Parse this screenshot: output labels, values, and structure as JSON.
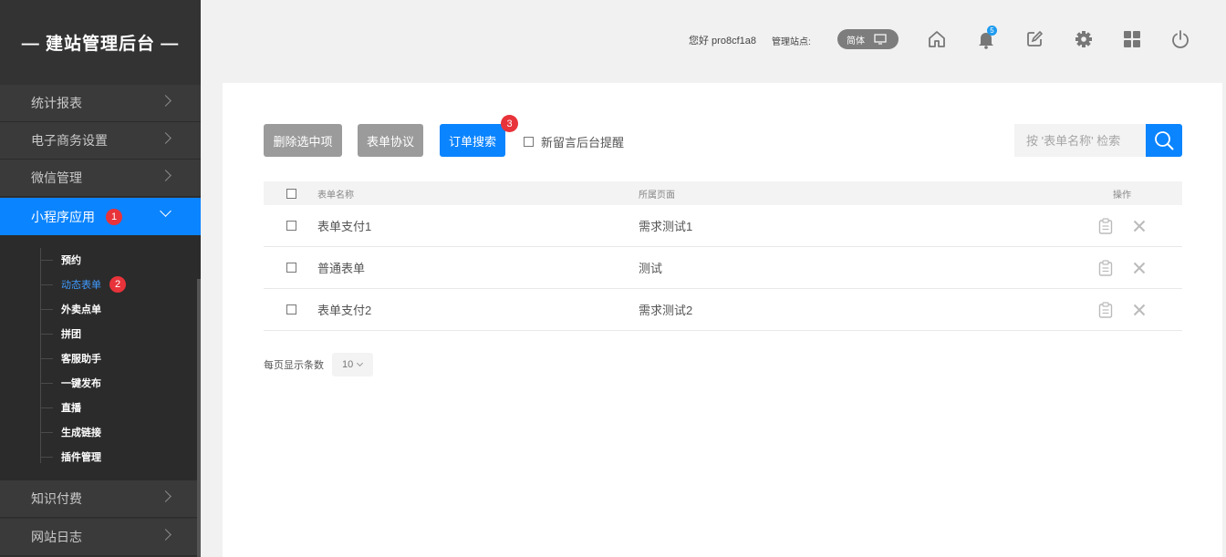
{
  "sidebar": {
    "brand": "— 建站管理后台 —",
    "items": [
      {
        "label": "统计报表"
      },
      {
        "label": "电子商务设置"
      },
      {
        "label": "微信管理"
      },
      {
        "label": "小程序应用",
        "badge": "1"
      },
      {
        "label": "知识付费"
      },
      {
        "label": "网站日志"
      }
    ],
    "submenu": [
      {
        "label": "预约"
      },
      {
        "label": "动态表单",
        "badge": "2"
      },
      {
        "label": "外卖点单"
      },
      {
        "label": "拼团"
      },
      {
        "label": "客服助手"
      },
      {
        "label": "一键发布"
      },
      {
        "label": "直播"
      },
      {
        "label": "生成链接"
      },
      {
        "label": "插件管理"
      }
    ]
  },
  "header": {
    "greeting": "您好 pro8cf1a8",
    "site_label": "管理站点:",
    "lang": "简体",
    "notification_count": "5",
    "icons": [
      "home-icon",
      "bell-icon",
      "edit-icon",
      "gear-icon",
      "grid-icon",
      "power-icon"
    ]
  },
  "toolbar": {
    "delete_label": "删除选中项",
    "agreement_label": "表单协议",
    "order_search_label": "订单搜索",
    "order_search_badge": "3",
    "notify_label": "新留言后台提醒",
    "search_placeholder": "按 '表单名称' 检索"
  },
  "table": {
    "headers": {
      "name": "表单名称",
      "page": "所属页面",
      "op": "操作"
    },
    "rows": [
      {
        "name": "表单支付1",
        "page": "需求测试1"
      },
      {
        "name": "普通表单",
        "page": "测试"
      },
      {
        "name": "表单支付2",
        "page": "需求测试2"
      }
    ]
  },
  "pager": {
    "label": "每页显示条数",
    "value": "10"
  },
  "colors": {
    "accent": "#0b84ff",
    "sidebar_bg": "#333333",
    "badge": "#e8333a"
  }
}
